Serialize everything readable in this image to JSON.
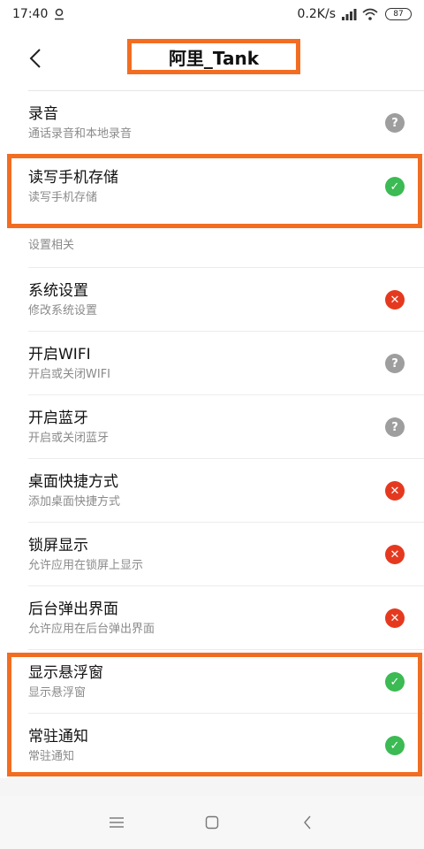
{
  "status_bar": {
    "time": "17:40",
    "net_speed": "0.2K/s",
    "battery": "87"
  },
  "header": {
    "title": "阿里_Tank"
  },
  "rows_top": [
    {
      "title": "录音",
      "subtitle": "通话录音和本地录音",
      "status": "unknown"
    },
    {
      "title": "读写手机存储",
      "subtitle": "读写手机存储",
      "status": "granted"
    }
  ],
  "section": {
    "title": "设置相关"
  },
  "rows": [
    {
      "title": "系统设置",
      "subtitle": "修改系统设置",
      "status": "denied"
    },
    {
      "title": "开启WIFI",
      "subtitle": "开启或关闭WIFI",
      "status": "unknown"
    },
    {
      "title": "开启蓝牙",
      "subtitle": "开启或关闭蓝牙",
      "status": "unknown"
    },
    {
      "title": "桌面快捷方式",
      "subtitle": "添加桌面快捷方式",
      "status": "denied"
    },
    {
      "title": "锁屏显示",
      "subtitle": "允许应用在锁屏上显示",
      "status": "denied"
    },
    {
      "title": "后台弹出界面",
      "subtitle": "允许应用在后台弹出界面",
      "status": "denied"
    },
    {
      "title": "显示悬浮窗",
      "subtitle": "显示悬浮窗",
      "status": "granted"
    },
    {
      "title": "常驻通知",
      "subtitle": "常驻通知",
      "status": "granted"
    }
  ],
  "status_glyphs": {
    "unknown": "?",
    "granted": "✓",
    "denied": "✕"
  },
  "colors": {
    "accent_highlight": "#f26d21",
    "granted": "#3cba54",
    "denied": "#e5391f",
    "unknown": "#9e9e9e"
  }
}
